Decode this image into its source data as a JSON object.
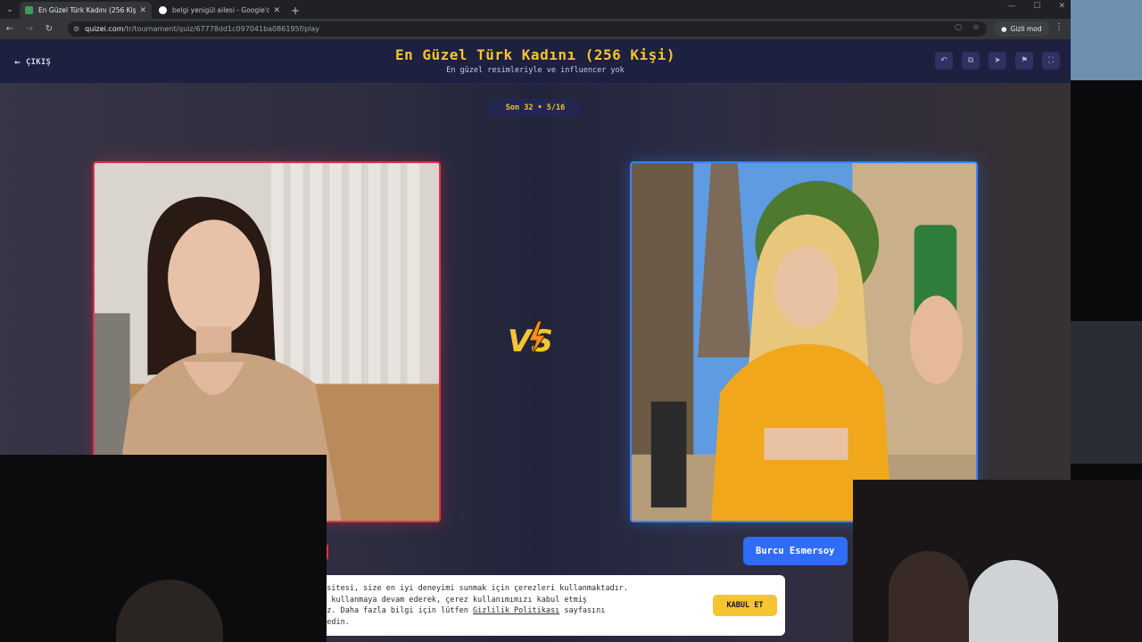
{
  "browser": {
    "tabs": [
      {
        "title": "En Güzel Türk Kadını (256 Kişi)",
        "active": true,
        "favicon_color": "#3f9c5a"
      },
      {
        "title": "belgi yenigül ailesi - Google'da",
        "active": false,
        "favicon_color": "#ffffff"
      }
    ],
    "new_tab_label": "+",
    "url_host": "quizei.com",
    "url_path": "/tr/tournament/quiz/67778dd1c097041ba086195f/play",
    "incognito_label": "Gizli mod"
  },
  "header": {
    "exit_label": "ÇIKIŞ",
    "title": "En Güzel Türk Kadını (256 Kişi)",
    "subtitle": "En güzel resimleriyle ve influencer yok",
    "action_icons": [
      "undo-icon",
      "share-icon",
      "send-icon",
      "flag-icon",
      "fullscreen-icon"
    ]
  },
  "round": {
    "label": "Son 32 • 5/16"
  },
  "versus": {
    "label": "VS",
    "left_border_color": "#e0334a",
    "right_border_color": "#3b82f6",
    "right_name": "Burcu Esmersoy"
  },
  "cookie": {
    "line1": "e sitesi, size en iyi deneyimi sunmak için çerezleri kullanmaktadır.",
    "line2": "zi kullanmaya devam ederek, çerez kullanımımızı kabul etmiş",
    "line3_pre": "nuz. Daha fazla bilgi için lütfen ",
    "line3_link": "Gizlilik Politikası",
    "line3_post": " sayfasını",
    "line4": "t edin.",
    "accept_label": "KABUL ET"
  },
  "colors": {
    "accent_yellow": "#f5c431",
    "header_bg": "#1e2040",
    "primary_blue": "#2f6df6"
  }
}
